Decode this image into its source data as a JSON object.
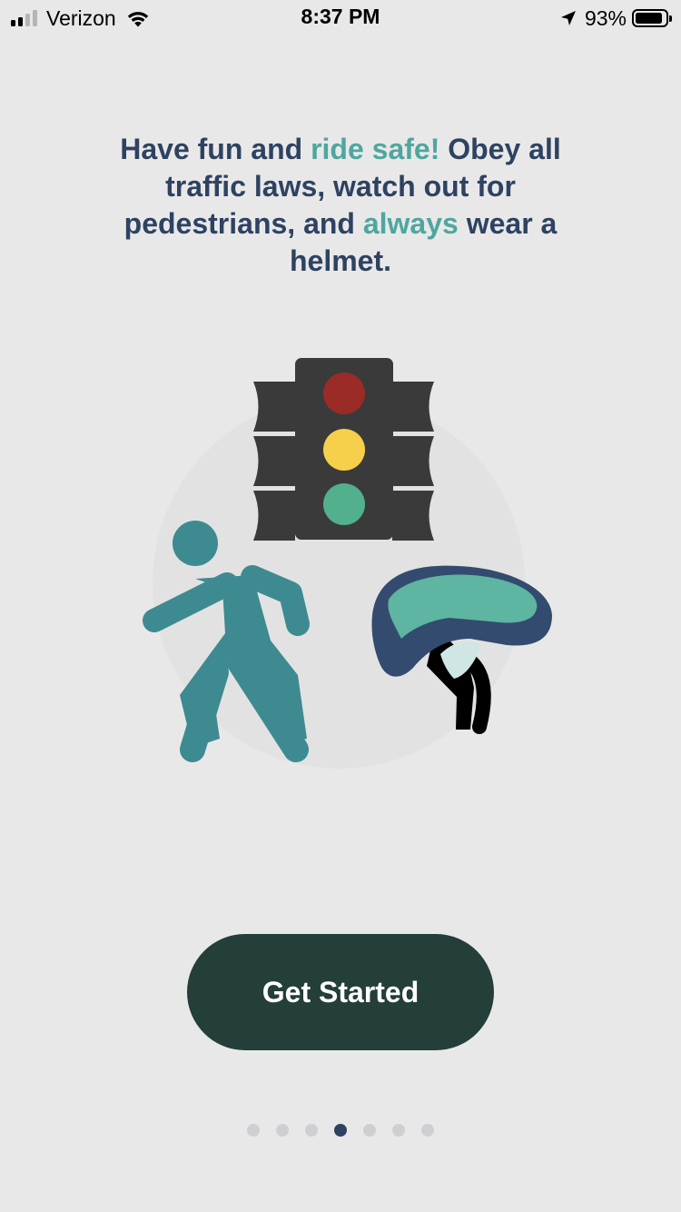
{
  "status_bar": {
    "carrier": "Verizon",
    "time": "8:37 PM",
    "battery_percent": "93%",
    "signal_bars_active": 2,
    "signal_bars_total": 4,
    "icons": [
      "cellular-signal-icon",
      "wifi-icon",
      "location-arrow-icon",
      "battery-icon"
    ]
  },
  "message": {
    "part1": "Have fun and ",
    "accent1": "ride safe!",
    "part2": " Obey all traffic laws, watch out for pedestrians, and ",
    "accent2": "always",
    "part3": " wear a helmet."
  },
  "illustration": {
    "elements": [
      "traffic-light",
      "pedestrian",
      "bike-helmet"
    ],
    "colors": {
      "circle_bg": "#e3e2e3",
      "traffic_light_body": "#3a3a3a",
      "red": "#9a2b26",
      "yellow": "#f6d04a",
      "green": "#52b08d",
      "pedestrian": "#3e8a91",
      "helmet_shell": "#334b6e",
      "helmet_vent": "#5db5a2",
      "helmet_strap": "#000000"
    }
  },
  "button": {
    "label": "Get Started"
  },
  "pagination": {
    "total": 7,
    "active_index": 3
  },
  "colors": {
    "background": "#e9e8e9",
    "text": "#2e4261",
    "accent": "#4ea79f",
    "button_bg": "#243e3a",
    "button_text": "#ffffff",
    "dot_inactive": "#cfcfd3",
    "dot_active": "#2f4161"
  }
}
